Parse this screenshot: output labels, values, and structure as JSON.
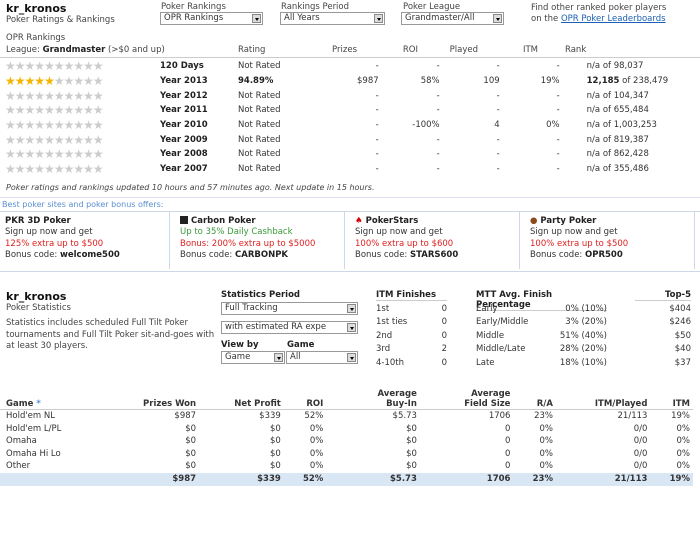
{
  "header": {
    "player": "kr_kronos",
    "subtitle": "Poker Ratings & Rankings",
    "filters": [
      {
        "label": "Poker Rankings",
        "value": "OPR Rankings"
      },
      {
        "label": "Rankings Period",
        "value": "All Years"
      },
      {
        "label": "Poker League",
        "value": "Grandmaster/All"
      }
    ],
    "find_text": "Find other ranked poker players",
    "find_prefix": "on the",
    "find_link": "OPR Poker Leaderboards"
  },
  "rankings": {
    "title": "OPR Rankings",
    "league_prefix": "League:",
    "league": "Grandmaster",
    "league_suffix": "(>$0 and up)",
    "columns": [
      "Rating",
      "Prizes",
      "ROI",
      "Played",
      "ITM",
      "Rank"
    ],
    "rows": [
      {
        "stars": 0,
        "period": "120 Days",
        "rating": "Not Rated",
        "prizes": "-",
        "roi": "-",
        "played": "-",
        "itm": "-",
        "rank": "n/a",
        "of": "of 98,037"
      },
      {
        "stars": 5,
        "period": "Year 2013",
        "rating": "94.89%",
        "prizes": "$987",
        "roi": "58%",
        "played": "109",
        "itm": "19%",
        "rank": "12,185",
        "of": "of 238,479"
      },
      {
        "stars": 0,
        "period": "Year 2012",
        "rating": "Not Rated",
        "prizes": "-",
        "roi": "-",
        "played": "-",
        "itm": "-",
        "rank": "n/a",
        "of": "of 104,347"
      },
      {
        "stars": 0,
        "period": "Year 2011",
        "rating": "Not Rated",
        "prizes": "-",
        "roi": "-",
        "played": "-",
        "itm": "-",
        "rank": "n/a",
        "of": "of 655,484"
      },
      {
        "stars": 0,
        "period": "Year 2010",
        "rating": "Not Rated",
        "prizes": "-",
        "roi": "-100%",
        "played": "4",
        "itm": "0%",
        "rank": "n/a",
        "of": "of 1,003,253"
      },
      {
        "stars": 0,
        "period": "Year 2009",
        "rating": "Not Rated",
        "prizes": "-",
        "roi": "-",
        "played": "-",
        "itm": "-",
        "rank": "n/a",
        "of": "of 819,387"
      },
      {
        "stars": 0,
        "period": "Year 2008",
        "rating": "Not Rated",
        "prizes": "-",
        "roi": "-",
        "played": "-",
        "itm": "-",
        "rank": "n/a",
        "of": "of 862,428"
      },
      {
        "stars": 0,
        "period": "Year 2007",
        "rating": "Not Rated",
        "prizes": "-",
        "roi": "-",
        "played": "-",
        "itm": "-",
        "rank": "n/a",
        "of": "of 355,486"
      }
    ],
    "update_note": "Poker ratings and rankings updated 10 hours and 57 minutes ago. Next update in 15 hours."
  },
  "bonus": {
    "heading": "Best poker sites and poker bonus offers:",
    "sites": [
      {
        "name": "PKR 3D Poker",
        "icon": "",
        "line1": "Sign up now and get",
        "line1_green": false,
        "offer": "125% extra up to $500",
        "code_label": "Bonus code:",
        "code": "welcome500"
      },
      {
        "name": "Carbon Poker",
        "icon": "carbon-icon",
        "line1": "Up to 35% Daily Cashback",
        "line1_green": true,
        "offer": "Bonus: 200% extra up to $5000",
        "code_label": "Bonus code:",
        "code": "CARBONPK"
      },
      {
        "name": "PokerStars",
        "icon": "pokerstars-spade-icon",
        "line1": "Sign up now and get",
        "line1_green": false,
        "offer": "100% extra up to $600",
        "code_label": "Bonus code:",
        "code": "STARS600"
      },
      {
        "name": "Party Poker",
        "icon": "partypoker-chip-icon",
        "line1": "Sign up now and get",
        "line1_green": false,
        "offer": "100% extra up to $500",
        "code_label": "Bonus code:",
        "code": "OPR500"
      }
    ]
  },
  "stats": {
    "player": "kr_kronos",
    "subtitle": "Poker Statistics",
    "note": "Statistics includes scheduled Full Tilt Poker tournaments and Full Tilt Poker sit-and-goes with at least 30 players.",
    "period_label": "Statistics Period",
    "period_value": "Full Tracking",
    "ra_value": "with estimated RA expe",
    "viewby_label": "View by",
    "viewby_value": "Game",
    "game_label": "Game",
    "game_value": "All",
    "itm": {
      "title": "ITM Finishes",
      "rows": [
        [
          "1st",
          "0"
        ],
        [
          "1st ties",
          "0"
        ],
        [
          "2nd",
          "0"
        ],
        [
          "3rd",
          "2"
        ],
        [
          "4-10th",
          "0"
        ]
      ]
    },
    "mtt": {
      "title": "MTT Avg. Finish Percentage",
      "rows": [
        [
          "Early",
          "0% (10%)"
        ],
        [
          "Early/Middle",
          "3% (20%)"
        ],
        [
          "Middle",
          "51% (40%)"
        ],
        [
          "Middle/Late",
          "28% (20%)"
        ],
        [
          "Late",
          "18% (10%)"
        ]
      ]
    },
    "top5": {
      "title": "Top-5",
      "values": [
        "$404",
        "$246",
        "$50",
        "$40",
        "$37"
      ]
    },
    "table": {
      "columns": [
        "Game",
        "Prizes Won",
        "Net Profit",
        "ROI",
        "Average Buy-In",
        "Average Field Size",
        "R/A",
        "ITM/Played",
        "ITM"
      ],
      "rows": [
        [
          "Hold'em NL",
          "$987",
          "$339",
          "52%",
          "$5.73",
          "1706",
          "23%",
          "21/113",
          "19%"
        ],
        [
          "Hold'em L/PL",
          "$0",
          "$0",
          "0%",
          "$0",
          "0",
          "0%",
          "0/0",
          "0%"
        ],
        [
          "Omaha",
          "$0",
          "$0",
          "0%",
          "$0",
          "0",
          "0%",
          "0/0",
          "0%"
        ],
        [
          "Omaha Hi Lo",
          "$0",
          "$0",
          "0%",
          "$0",
          "0",
          "0%",
          "0/0",
          "0%"
        ],
        [
          "Other",
          "$0",
          "$0",
          "0%",
          "$0",
          "0",
          "0%",
          "0/0",
          "0%"
        ]
      ],
      "total": [
        "",
        "$987",
        "$339",
        "52%",
        "$5.73",
        "1706",
        "23%",
        "21/113",
        "19%"
      ]
    }
  },
  "colors": {
    "link": "#1a5fb4",
    "offer": "#e02020",
    "cashback": "#3a9a3a",
    "star": "#f4b400",
    "total_row": "#d9e6f4"
  }
}
